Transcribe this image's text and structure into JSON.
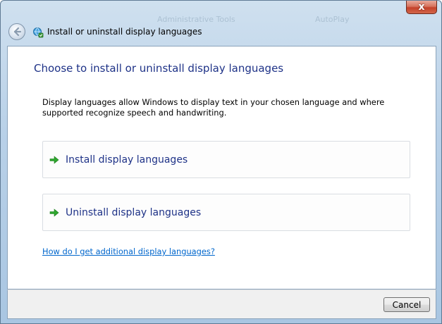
{
  "window": {
    "close_glyph": "x",
    "background_glimpse": [
      "Administrative Tools",
      "AutoPlay"
    ]
  },
  "nav": {
    "title": "Install or uninstall display languages"
  },
  "content": {
    "heading": "Choose to install or uninstall display languages",
    "description": "Display languages allow Windows to display text in your chosen language and where supported recognize speech and handwriting.",
    "options": [
      {
        "label": "Install display languages",
        "icon": "green-arrow-icon"
      },
      {
        "label": "Uninstall display languages",
        "icon": "green-arrow-icon"
      }
    ],
    "help_link": "How do I get additional display languages?"
  },
  "footer": {
    "cancel_label": "Cancel"
  },
  "colors": {
    "heading": "#1e3287",
    "link": "#0066cc",
    "arrow": "#2fa72f"
  }
}
